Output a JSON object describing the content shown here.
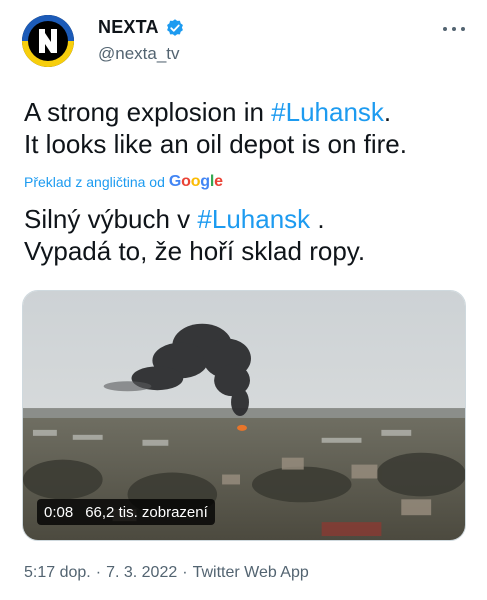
{
  "tweet": {
    "author_name": "NEXTA",
    "author_handle": "@nexta_tv",
    "original_text_1": "A strong explosion in ",
    "original_hashtag": "#Luhansk",
    "original_text_2": ".",
    "original_line_2": "It looks like an oil depot is on fire.",
    "translate_label": "Překlad z angličtina od",
    "translate_provider": "Google",
    "translated_text_1": "Silný výbuch v ",
    "translated_hashtag": "#Luhansk",
    "translated_text_2": " .",
    "translated_line_2": "Vypadá to, že hoří sklad ropy.",
    "video_time": "0:08",
    "video_views": "66,2 tis. zobrazení",
    "time": "5:17 dop.",
    "separator": "·",
    "date": "7. 3. 2022",
    "source": "Twitter Web App"
  },
  "icons": {
    "verified": "verified-badge-icon",
    "more": "more-options-icon"
  },
  "colors": {
    "accent": "#1d9bf0",
    "secondary_text": "#536471"
  }
}
